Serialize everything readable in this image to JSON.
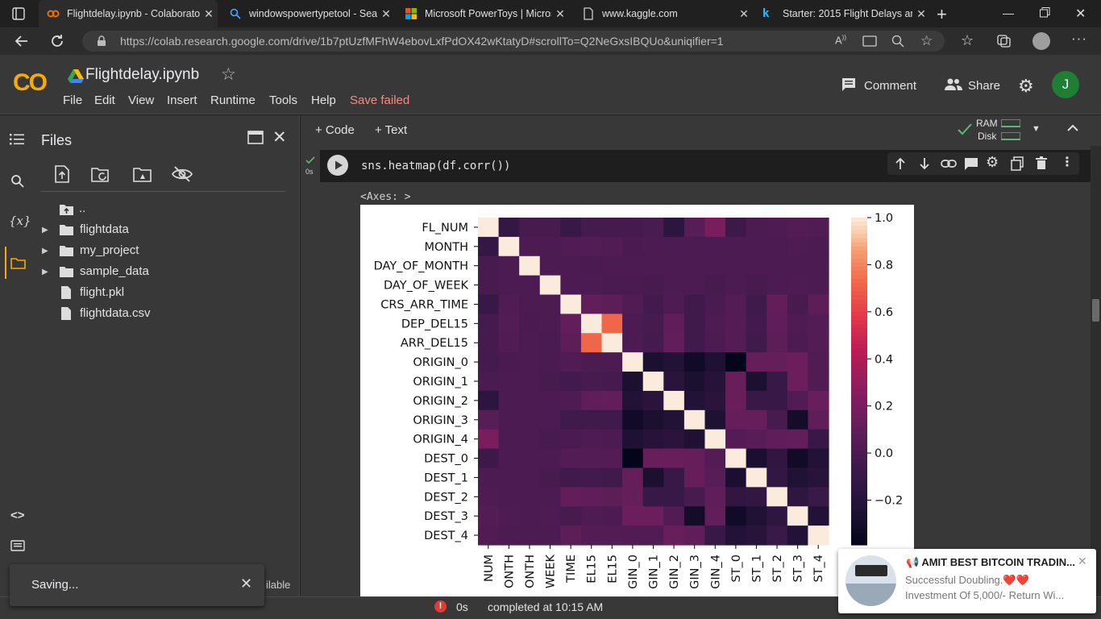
{
  "browser": {
    "tabs": [
      {
        "title": "Flightdelay.ipynb - Colaborato",
        "active": true
      },
      {
        "title": "windowspowertypetool - Sea",
        "active": false
      },
      {
        "title": "Microsoft PowerToys | Micros",
        "active": false
      },
      {
        "title": "www.kaggle.com",
        "active": false
      },
      {
        "title": "Starter: 2015 Flight Delays an",
        "active": false
      }
    ],
    "url": "https://colab.research.google.com/drive/1b7ptUzfMFhW4ebovLxfPdOX42wKtatyD#scrollTo=Q2NeGxsIBQUo&uniqifier=1"
  },
  "colab": {
    "logo": "CO",
    "title": "Flightdelay.ipynb",
    "menu": [
      "File",
      "Edit",
      "View",
      "Insert",
      "Runtime",
      "Tools",
      "Help"
    ],
    "save_status": "Save failed",
    "comment_label": "Comment",
    "share_label": "Share",
    "avatar_letter": "J",
    "add_code": "+ Code",
    "add_text": "+ Text",
    "ram_label": "RAM",
    "disk_label": "Disk"
  },
  "sidebar": {
    "title": "Files",
    "tree": [
      {
        "name": "..",
        "type": "up"
      },
      {
        "name": "flightdata",
        "type": "folder"
      },
      {
        "name": "my_project",
        "type": "folder"
      },
      {
        "name": "sample_data",
        "type": "folder"
      },
      {
        "name": "flight.pkl",
        "type": "file"
      },
      {
        "name": "flightdata.csv",
        "type": "file"
      }
    ],
    "footer_partial": "ilable"
  },
  "cell": {
    "code": "sns.heatmap(df.corr())",
    "exec_time": "0s",
    "output_text": "<Axes: >"
  },
  "chart_data": {
    "type": "heatmap",
    "title": "",
    "labels": [
      "FL_NUM",
      "MONTH",
      "DAY_OF_MONTH",
      "DAY_OF_WEEK",
      "CRS_ARR_TIME",
      "DEP_DEL15",
      "ARR_DEL15",
      "ORIGIN_0",
      "ORIGIN_1",
      "ORIGIN_2",
      "ORIGIN_3",
      "ORIGIN_4",
      "DEST_0",
      "DEST_1",
      "DEST_2",
      "DEST_3",
      "DEST_4"
    ],
    "x_tick_labels_visible": [
      "NUM",
      "ONTH",
      "ONTH",
      "WEEK",
      "TIME",
      "EL15",
      "EL15",
      "GIN_0",
      "GIN_1",
      "GIN_2",
      "GIN_3",
      "GIN_4",
      "ST_0",
      "ST_1",
      "ST_2",
      "ST_3",
      "ST_4"
    ],
    "colorbar_ticks": [
      1.0,
      0.8,
      0.6,
      0.4,
      0.2,
      0.0,
      -0.2
    ],
    "colorbar_tick_labels": [
      "1.0",
      "0.8",
      "0.6",
      "0.4",
      "0.2",
      "0.0",
      "−0.2"
    ],
    "vmin": -0.39,
    "vmax": 1.0,
    "colormap": "rocket",
    "matrix": [
      [
        1.0,
        -0.12,
        -0.02,
        -0.02,
        -0.1,
        -0.03,
        -0.03,
        -0.03,
        -0.01,
        -0.17,
        0.05,
        0.2,
        -0.07,
        0.0,
        0.01,
        0.04,
        0.02
      ],
      [
        -0.12,
        1.0,
        0.0,
        0.0,
        0.02,
        0.03,
        0.02,
        -0.01,
        0.0,
        0.0,
        0.0,
        0.0,
        0.0,
        0.0,
        0.0,
        0.01,
        0.0
      ],
      [
        -0.02,
        0.0,
        1.0,
        0.0,
        0.0,
        -0.01,
        0.0,
        0.0,
        0.0,
        0.0,
        0.0,
        0.0,
        0.0,
        0.0,
        0.0,
        0.0,
        0.0
      ],
      [
        -0.02,
        0.0,
        0.0,
        1.0,
        0.0,
        0.0,
        -0.01,
        -0.01,
        -0.02,
        0.0,
        0.0,
        -0.02,
        0.0,
        -0.02,
        0.0,
        0.01,
        0.0
      ],
      [
        -0.1,
        0.02,
        0.0,
        0.0,
        1.0,
        0.1,
        0.08,
        0.02,
        -0.04,
        0.01,
        -0.06,
        -0.01,
        0.04,
        -0.06,
        0.11,
        -0.02,
        0.08
      ],
      [
        -0.03,
        0.03,
        -0.01,
        0.0,
        0.1,
        1.0,
        0.72,
        0.0,
        -0.02,
        0.09,
        -0.06,
        0.01,
        0.04,
        -0.04,
        0.09,
        0.01,
        0.04
      ],
      [
        -0.03,
        0.02,
        0.0,
        -0.01,
        0.08,
        0.72,
        1.0,
        0.0,
        -0.03,
        0.1,
        -0.05,
        0.0,
        0.04,
        -0.05,
        0.08,
        0.0,
        0.04
      ],
      [
        -0.03,
        -0.01,
        0.0,
        -0.01,
        0.02,
        0.0,
        0.0,
        1.0,
        -0.26,
        -0.23,
        -0.32,
        -0.25,
        -0.39,
        0.12,
        0.12,
        0.14,
        0.02
      ],
      [
        -0.01,
        0.0,
        0.0,
        -0.02,
        -0.04,
        -0.02,
        -0.03,
        -0.26,
        1.0,
        -0.18,
        -0.26,
        -0.2,
        0.13,
        -0.26,
        -0.1,
        0.14,
        0.02
      ],
      [
        -0.17,
        0.0,
        0.0,
        0.0,
        0.01,
        0.09,
        0.1,
        -0.23,
        -0.18,
        1.0,
        -0.23,
        -0.18,
        0.13,
        -0.1,
        -0.1,
        0.02,
        0.13
      ],
      [
        0.05,
        0.0,
        0.0,
        0.0,
        -0.06,
        -0.06,
        -0.05,
        -0.32,
        -0.26,
        -0.23,
        1.0,
        -0.25,
        0.12,
        0.12,
        -0.02,
        -0.3,
        0.09
      ],
      [
        0.2,
        0.0,
        0.0,
        -0.02,
        -0.01,
        0.01,
        0.0,
        -0.25,
        -0.2,
        -0.18,
        -0.25,
        1.0,
        0.04,
        0.05,
        0.09,
        0.1,
        -0.1
      ],
      [
        -0.07,
        0.0,
        0.0,
        0.0,
        0.04,
        0.04,
        0.04,
        -0.39,
        0.13,
        0.13,
        0.12,
        0.04,
        1.0,
        -0.27,
        -0.14,
        -0.32,
        -0.22
      ],
      [
        0.0,
        0.0,
        0.0,
        -0.02,
        -0.06,
        -0.04,
        -0.05,
        0.12,
        -0.26,
        -0.1,
        0.12,
        0.05,
        -0.27,
        1.0,
        -0.13,
        -0.24,
        -0.19
      ],
      [
        0.01,
        0.0,
        0.0,
        0.0,
        0.11,
        0.09,
        0.08,
        0.12,
        -0.1,
        -0.1,
        -0.02,
        0.09,
        -0.14,
        -0.13,
        1.0,
        -0.15,
        -0.09
      ],
      [
        0.04,
        0.01,
        0.0,
        0.01,
        -0.02,
        0.01,
        0.0,
        0.14,
        0.14,
        0.02,
        -0.3,
        0.1,
        -0.32,
        -0.24,
        -0.15,
        1.0,
        -0.22
      ],
      [
        0.02,
        0.0,
        0.0,
        0.0,
        0.08,
        0.04,
        0.04,
        0.02,
        0.02,
        0.13,
        0.09,
        -0.1,
        -0.22,
        -0.19,
        -0.09,
        -0.22,
        1.0
      ]
    ]
  },
  "status": {
    "time": "0s",
    "completed": "completed at 10:15 AM"
  },
  "toast": {
    "text": "Saving..."
  },
  "ad": {
    "title": "📢 AMIT BEST BITCOIN TRADIN...",
    "line1": "Successful Doubling.❤️❤️",
    "line2": "Investment Of 5,000/- Return Wi..."
  },
  "colors": {
    "accent_orange": "#f9ab00",
    "save_failed": "#f28b82",
    "avatar_bg": "#1e7e34",
    "check_green": "#5bb974"
  }
}
